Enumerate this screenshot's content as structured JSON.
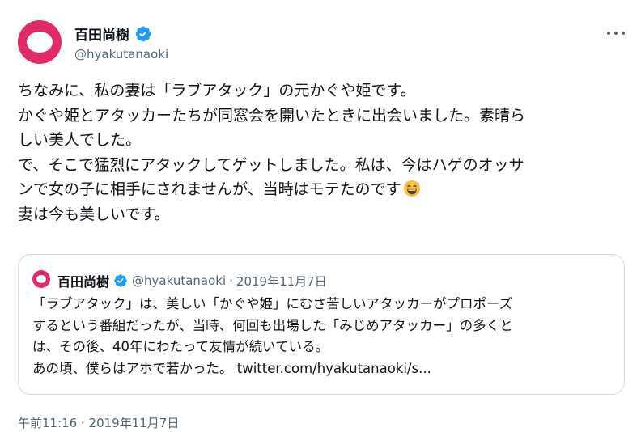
{
  "author": {
    "name": "百田尚樹",
    "handle": "@hyakutanaoki",
    "avatar_color": "#e32a68",
    "verified_icon": "verified-badge-icon"
  },
  "more_icon": "more-options-icon",
  "body": {
    "lines": [
      "ちなみに、私の妻は「ラブアタック」の元かぐや姫です。",
      "かぐや姫とアタッカーたちが同窓会を開いたときに出会いました。素晴ら",
      "しい美人でした。",
      "で、そこで猛烈にアタックしてゲットしました。私は、今はハゲのオッサ",
      "ンで女の子に相手にされませんが、当時はモテたのです",
      "妻は今も美しいです。"
    ],
    "emoji": "grinning-sweat-emoji"
  },
  "quote": {
    "name": "百田尚樹",
    "handle": "@hyakutanaoki",
    "separator": "·",
    "date": "2019年11月7日",
    "lines": [
      "「ラブアタック」は、美しい「かぐや姫」にむさ苦しいアタッカーがプロポーズ",
      "するという番組だったが、当時、何回も出場した「みじめアタッカー」の多くと",
      "は、その後、40年にわたって友情が続いている。"
    ],
    "last_line_text": "あの頃、僕らはアホで若かった。",
    "link": "twitter.com/hyakutanaoki/s..."
  },
  "footer": {
    "timestamp": "午前11:16 · 2019年11月7日"
  },
  "colors": {
    "text_primary": "#0f1419",
    "text_secondary": "#536471",
    "verified_blue": "#1d9bf0",
    "border": "#cfd9de"
  }
}
